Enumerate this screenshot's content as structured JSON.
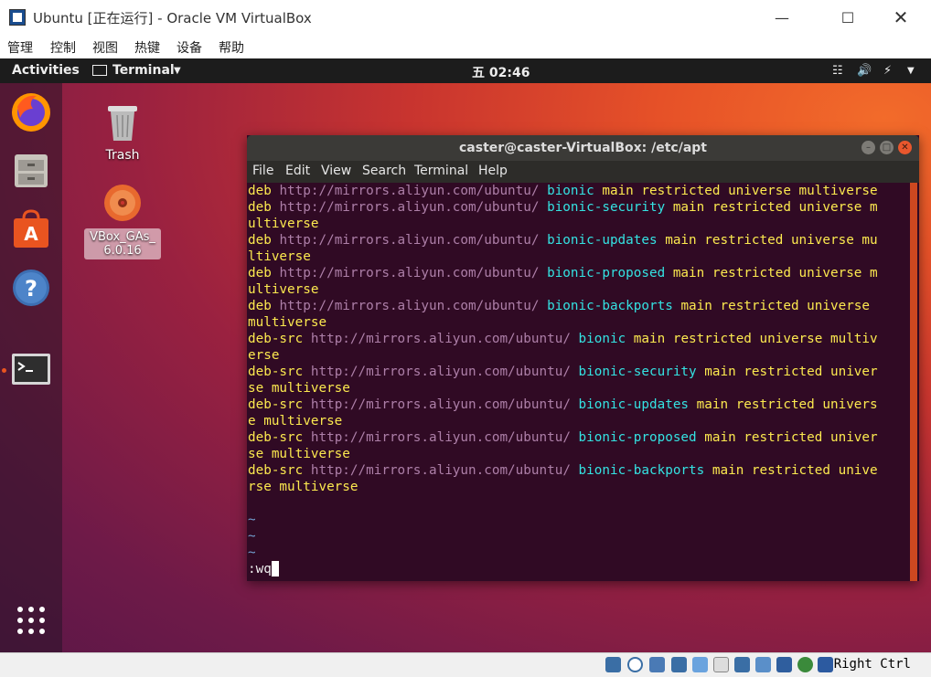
{
  "vbox": {
    "title": "Ubuntu [正在运行] - Oracle VM VirtualBox",
    "menu": [
      "管理",
      "控制",
      "视图",
      "热键",
      "设备",
      "帮助"
    ],
    "host_key": "Right Ctrl"
  },
  "gnome": {
    "activities": "Activities",
    "app_menu": "Terminal",
    "clock": "五 02:46"
  },
  "desktop": {
    "trash_label": "Trash",
    "vbox_cd_label": "VBox_GAs_ 6.0.16"
  },
  "terminal": {
    "title": "caster@caster-VirtualBox: /etc/apt",
    "menu": [
      "File",
      "Edit",
      "View",
      "Search",
      "Terminal",
      "Help"
    ],
    "command_line": ":wq",
    "tildes": [
      "~",
      "~",
      "~"
    ]
  },
  "colors": {
    "accent": "#e95420",
    "terminal_bg": "#300a24"
  }
}
